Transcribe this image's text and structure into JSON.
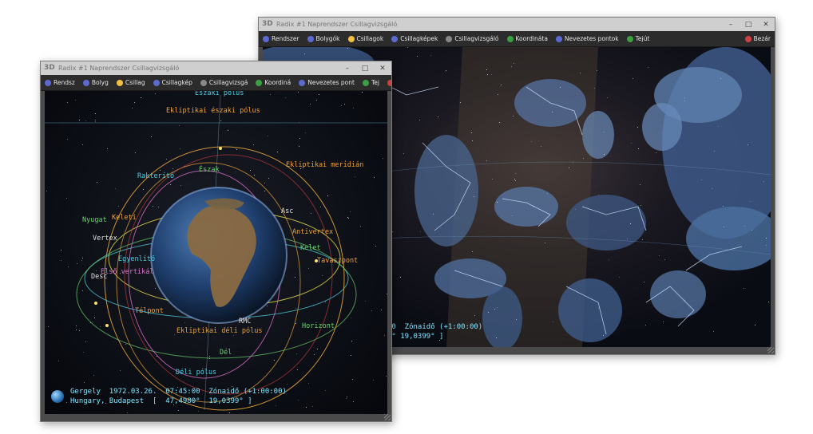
{
  "back_window": {
    "logo": "3D",
    "title": "Radix #1 Naprendszer Csillagvizsgáló",
    "controls": [
      "–",
      "□",
      "✕"
    ],
    "menu": [
      {
        "label": "Rendszer",
        "icon": "planet-icon",
        "color": "#5a6ad0"
      },
      {
        "label": "Bolygók",
        "icon": "planet-icon",
        "color": "#5a6ad0"
      },
      {
        "label": "Csillagok",
        "icon": "star-icon",
        "color": "#f0c040"
      },
      {
        "label": "Csillagképek",
        "icon": "constellation-icon",
        "color": "#5a6ad0"
      },
      {
        "label": "Csillagvizsgáló",
        "icon": "observatory-icon",
        "color": "#888888"
      },
      {
        "label": "Koordináta",
        "icon": "globe-icon",
        "color": "#3aa040"
      },
      {
        "label": "Nevezetes pontok",
        "icon": "points-icon",
        "color": "#5a6ad0"
      },
      {
        "label": "Tejút",
        "icon": "milky-way-icon",
        "color": "#3aa040"
      },
      {
        "label": "Bezár",
        "icon": "close-icon",
        "color": "#d04040"
      }
    ],
    "status_line1": "00  Zónaidő (+1:00:00)",
    "status_line2": "0° 19,0399° ]"
  },
  "front_window": {
    "logo": "3D",
    "title": "Radix #1 Naprendszer Csillagvizsgáló",
    "controls": [
      "–",
      "□",
      "✕"
    ],
    "menu": [
      {
        "label": "Rendsz",
        "icon": "planet-icon",
        "color": "#5a6ad0"
      },
      {
        "label": "Bolyg",
        "icon": "planet-icon",
        "color": "#5a6ad0"
      },
      {
        "label": "Csillag",
        "icon": "star-icon",
        "color": "#f0c040"
      },
      {
        "label": "Csillagkép",
        "icon": "constellation-icon",
        "color": "#5a6ad0"
      },
      {
        "label": "Csillagvizsgá",
        "icon": "observatory-icon",
        "color": "#888888"
      },
      {
        "label": "Koordiná",
        "icon": "globe-icon",
        "color": "#3aa040"
      },
      {
        "label": "Nevezetes pont",
        "icon": "points-icon",
        "color": "#5a6ad0"
      },
      {
        "label": "Tej",
        "icon": "milky-way-icon",
        "color": "#3aa040"
      },
      {
        "label": "Bezár",
        "icon": "close-icon",
        "color": "#d04040"
      }
    ],
    "labels": {
      "north_pole": "Északi pólus",
      "ecl_north_pole": "Ekliptikai északi pólus",
      "ecl_meridian": "Ekliptikai meridián",
      "spring_point_r": "Rakterító",
      "north": "Észak",
      "west": "Nyugat",
      "east_point": "Keleti",
      "vertex": "Vertex",
      "asc": "Asc",
      "antivertex": "Antivertex",
      "east": "Kelet",
      "equator": "Egyenlítő",
      "spring_point": "Tavaszpont",
      "desc": "Desc",
      "prime_vertical": "Első vertikál",
      "winter_point": "Télpont",
      "rmc": "RMC",
      "ecl_south_pole": "Ekliptikai déli pólus",
      "horizon": "Horizont",
      "south": "Dél",
      "south_pole": "Déli pólus"
    },
    "status_line1": "Gergely  1972.03.26.  07:45:00  Zónaidő (+1:00:00)",
    "status_line2": "Hungary, Budapest  [  47,4980°  19,0399° ]"
  }
}
